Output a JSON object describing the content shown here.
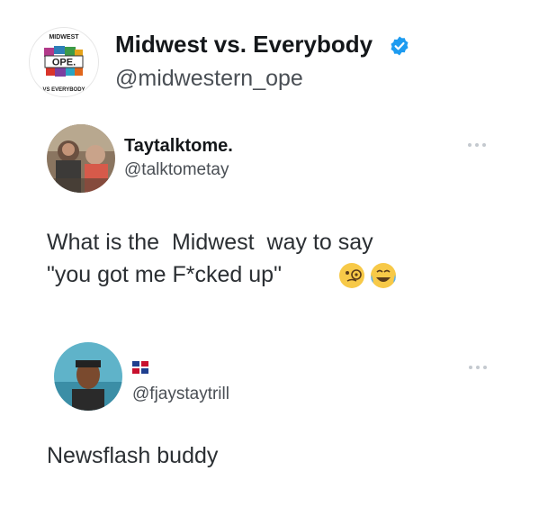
{
  "account": {
    "name": "Midwest vs. Everybody",
    "handle": "@midwestern_ope",
    "verified": true,
    "logo": {
      "top_text": "MIDWEST",
      "center_text": "OPE.",
      "bottom_text": "VS EVERYBODY"
    }
  },
  "tweets": [
    {
      "name": "Taytalktome.",
      "handle": "@talktometay",
      "text_line1": "What is the  Midwest  way to say",
      "text_line2": "\"you got me F*cked up\"",
      "emojis": [
        "face-with-monocle",
        "face-with-tears-of-joy"
      ],
      "more_icon": "more-dots-icon"
    },
    {
      "flag": "dominican-republic-flag",
      "handle": "@fjaystaytrill",
      "text": "Newsflash buddy",
      "more_icon": "more-dots-icon"
    }
  ],
  "colors": {
    "text_primary": "#14171a",
    "text_secondary": "#4a4f55",
    "verified_blue": "#1d9bf0",
    "more_dots": "#c4c9cf"
  }
}
